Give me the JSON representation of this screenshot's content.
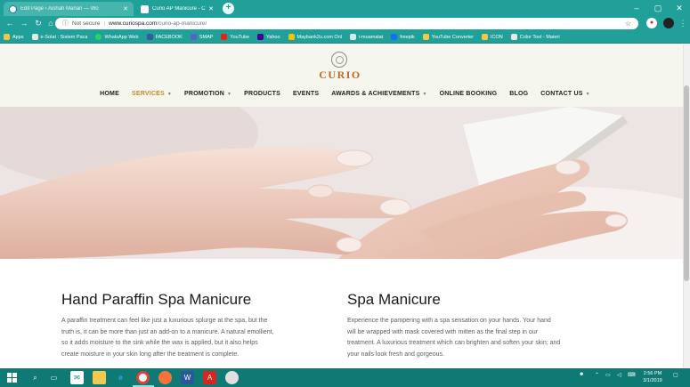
{
  "browser": {
    "tabs": [
      {
        "label": "Edit Page ‹ Aishah Manan — Wo",
        "active": false
      },
      {
        "label": "Curio AP Manicure - Curio Spa",
        "active": true
      }
    ],
    "address": {
      "security": "Not secure",
      "host": "www.curiospa.com",
      "path": "/curio-ap-manicure/"
    },
    "bookmarks": [
      "Apps",
      "e-Solat : Sistem Paca",
      "WhatsApp Web",
      "FACEBOOK",
      "SMAP",
      "YouTube",
      "Yahoo",
      "Maybank2u.com Onl",
      "i-muamalat",
      "freepik",
      "YouTube Converter",
      "ICON",
      "Color Tool - Materi"
    ]
  },
  "site": {
    "logo_text": "CURIO",
    "nav": [
      {
        "label": "HOME",
        "has_dropdown": false,
        "current": false
      },
      {
        "label": "SERVICES",
        "has_dropdown": true,
        "current": true
      },
      {
        "label": "PROMOTION",
        "has_dropdown": true,
        "current": false
      },
      {
        "label": "PRODUCTS",
        "has_dropdown": false,
        "current": false
      },
      {
        "label": "EVENTS",
        "has_dropdown": false,
        "current": false
      },
      {
        "label": "AWARDS & ACHIEVEMENTS",
        "has_dropdown": true,
        "current": false
      },
      {
        "label": "ONLINE BOOKING",
        "has_dropdown": false,
        "current": false
      },
      {
        "label": "BLOG",
        "has_dropdown": false,
        "current": false
      },
      {
        "label": "CONTACT US",
        "has_dropdown": true,
        "current": false
      }
    ],
    "sections": [
      {
        "title": "Hand Paraffin Spa Manicure",
        "body": "A paraffin treatment can feel like just a luxurious splurge at the spa, but the truth is, it can be more than just an add-on to a manicure. A natural emollient, so it adds moisture to the sink while the wax is applied, but it also helps create moisture in your skin long after the treatment is complete."
      },
      {
        "title": "Spa Manicure",
        "body": "Experience the pampering with a spa sensation on your hands. Your hand will be wrapped with mask covered with mitten as the final step in our treatment. A luxurious treatment which can brighten and soften your skin; and your nails look fresh and gorgeous."
      }
    ]
  },
  "taskbar": {
    "time": "2:56 PM",
    "date": "3/1/2019"
  },
  "colors": {
    "chrome": "#21a09a",
    "accent_nav": "#c48a2b",
    "logo": "#c4652a",
    "taskbar": "#0f7a73"
  }
}
